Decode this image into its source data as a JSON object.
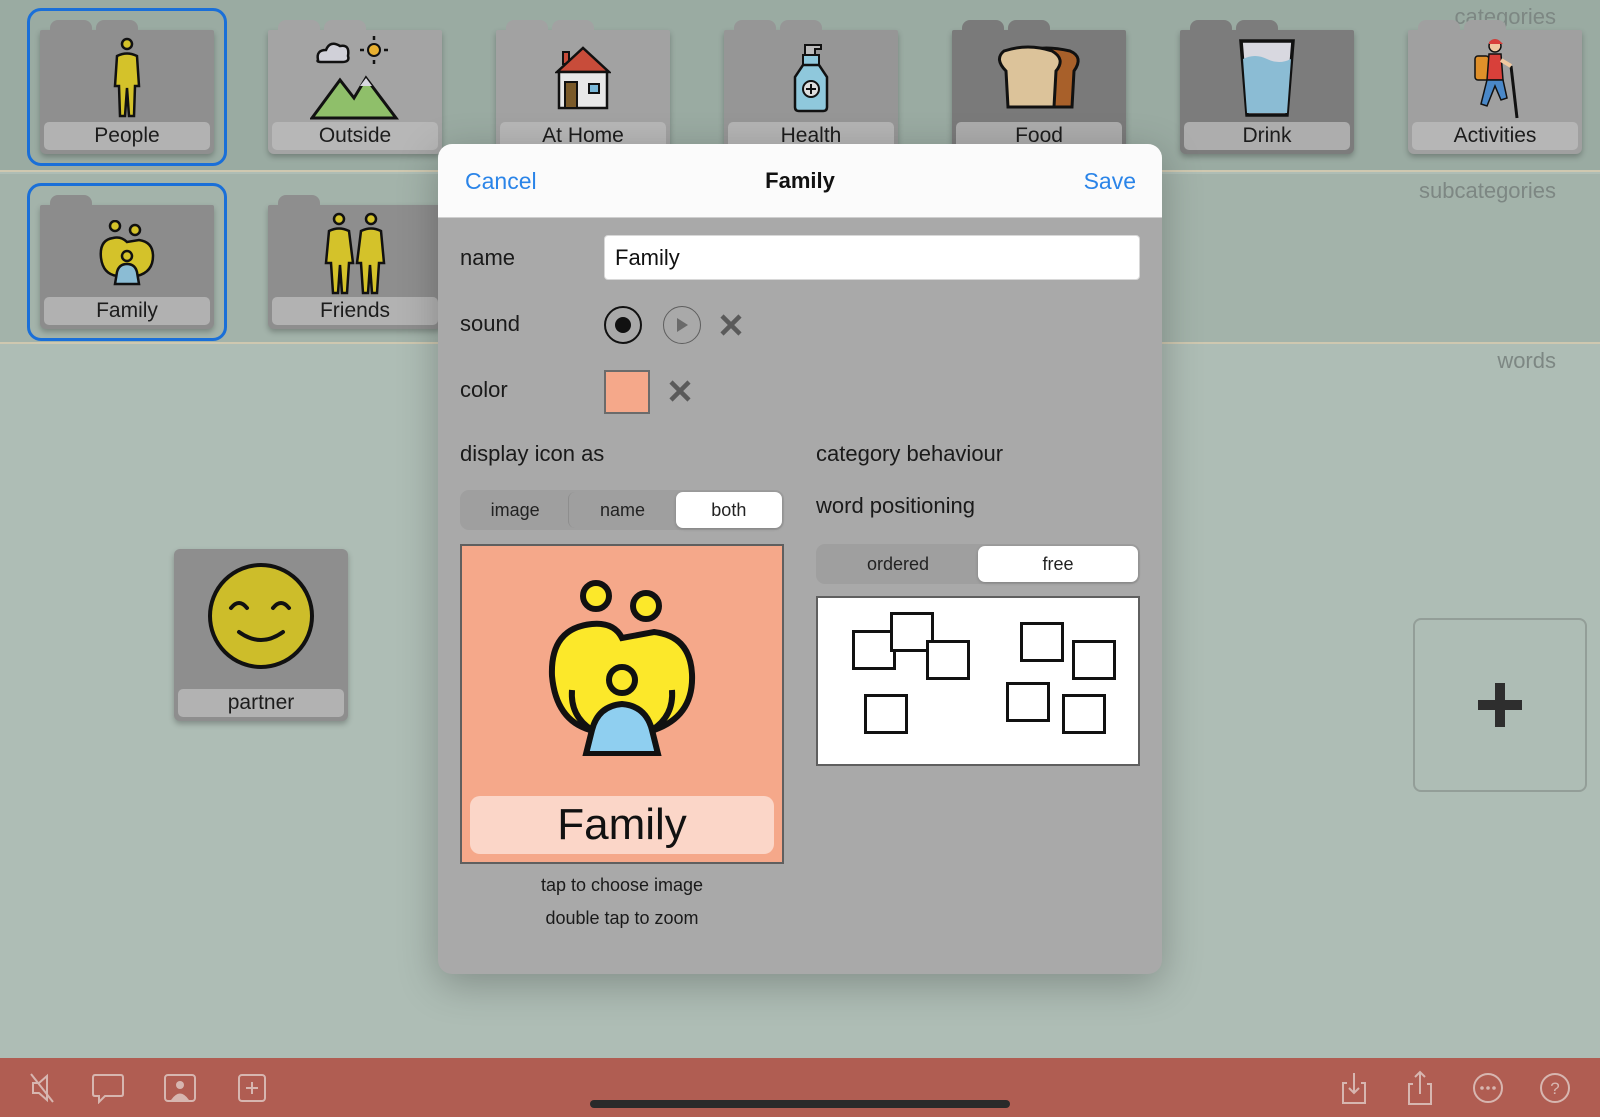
{
  "sections": {
    "categories_label": "categories",
    "subcategories_label": "subcategories",
    "words_label": "words"
  },
  "categories": [
    {
      "label": "People",
      "icon": "person-icon",
      "selected": true
    },
    {
      "label": "Outside",
      "icon": "mountain-sun-icon",
      "selected": false
    },
    {
      "label": "At Home",
      "icon": "house-icon",
      "selected": false
    },
    {
      "label": "Health",
      "icon": "sanitizer-bottle-icon",
      "selected": false
    },
    {
      "label": "Food",
      "icon": "bread-icon",
      "selected": false
    },
    {
      "label": "Drink",
      "icon": "glass-of-water-icon",
      "selected": false
    },
    {
      "label": "Activities",
      "icon": "hiker-icon",
      "selected": false
    }
  ],
  "subcategories": [
    {
      "label": "Family",
      "icon": "family-icon",
      "selected": true
    },
    {
      "label": "Friends",
      "icon": "friends-icon",
      "selected": false
    }
  ],
  "words": [
    {
      "label": "partner",
      "icon": "smiling-face-icon"
    }
  ],
  "add_word_icon": "plus-icon",
  "dialog": {
    "title": "Family",
    "cancel_label": "Cancel",
    "save_label": "Save",
    "name_label": "name",
    "name_value": "Family",
    "sound_label": "sound",
    "color_label": "color",
    "color_value": "#f5a88a",
    "display_icon_label": "display icon as",
    "display_options": [
      "image",
      "name",
      "both"
    ],
    "display_selected": "both",
    "category_behaviour_label": "category behaviour",
    "word_positioning_label": "word positioning",
    "positioning_options": [
      "ordered",
      "free"
    ],
    "positioning_selected": "free",
    "preview_label": "Family",
    "hint_choose": "tap to choose image",
    "hint_zoom": "double tap to zoom"
  },
  "colors": {
    "accent": "#2a84e8",
    "selection_ring": "#1a6fd8",
    "toolbar": "#b05d52"
  },
  "toolbar": {
    "left_icons": [
      "mute-speaker-icon",
      "speech-bubble-icon",
      "contact-card-icon",
      "add-square-icon"
    ],
    "right_icons": [
      "import-icon",
      "share-icon",
      "more-icon",
      "help-icon"
    ]
  }
}
